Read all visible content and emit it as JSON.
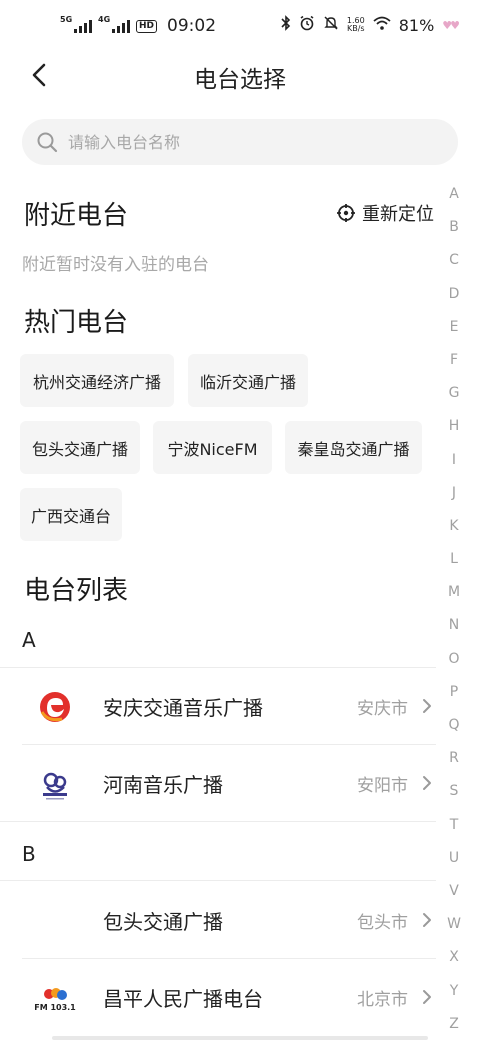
{
  "status_bar": {
    "net1": "5G",
    "net2": "4G",
    "hd": "HD",
    "time": "09:02",
    "speed_value": "1.60",
    "speed_unit": "KB/s",
    "battery": "81%",
    "icons": [
      "bluetooth-icon",
      "alarm-icon",
      "mute-icon",
      "wifi-icon"
    ]
  },
  "header": {
    "title": "电台选择"
  },
  "search": {
    "placeholder": "请输入电台名称",
    "value": ""
  },
  "nearby": {
    "title": "附近电台",
    "relocate_label": "重新定位",
    "empty_text": "附近暂时没有入驻的电台"
  },
  "hot": {
    "title": "热门电台",
    "chips": [
      "杭州交通经济广播",
      "临沂交通广播",
      "包头交通广播",
      "宁波NiceFM",
      "秦皇岛交通广播",
      "广西交通台"
    ]
  },
  "list": {
    "title": "电台列表",
    "groups": [
      {
        "letter": "A",
        "items": [
          {
            "name": "安庆交通音乐广播",
            "city": "安庆市",
            "logo": "anqing-logo"
          },
          {
            "name": "河南音乐广播",
            "city": "安阳市",
            "logo": "henan-music-logo"
          }
        ]
      },
      {
        "letter": "B",
        "items": [
          {
            "name": "包头交通广播",
            "city": "包头市",
            "logo": ""
          },
          {
            "name": "昌平人民广播电台",
            "city": "北京市",
            "logo": "fm-103-logo",
            "logo_text": "FM 103.1"
          }
        ]
      }
    ]
  },
  "index_letters": [
    "A",
    "B",
    "C",
    "D",
    "E",
    "F",
    "G",
    "H",
    "I",
    "J",
    "K",
    "L",
    "M",
    "N",
    "O",
    "P",
    "Q",
    "R",
    "S",
    "T",
    "U",
    "V",
    "W",
    "X",
    "Y",
    "Z"
  ],
  "colors": {
    "accent": "#222222",
    "muted": "#a0a0a0",
    "chip_bg": "#f5f5f5",
    "search_bg": "#f3f3f3",
    "logo_red": "#e2302b",
    "logo_orange": "#f39a1e"
  }
}
